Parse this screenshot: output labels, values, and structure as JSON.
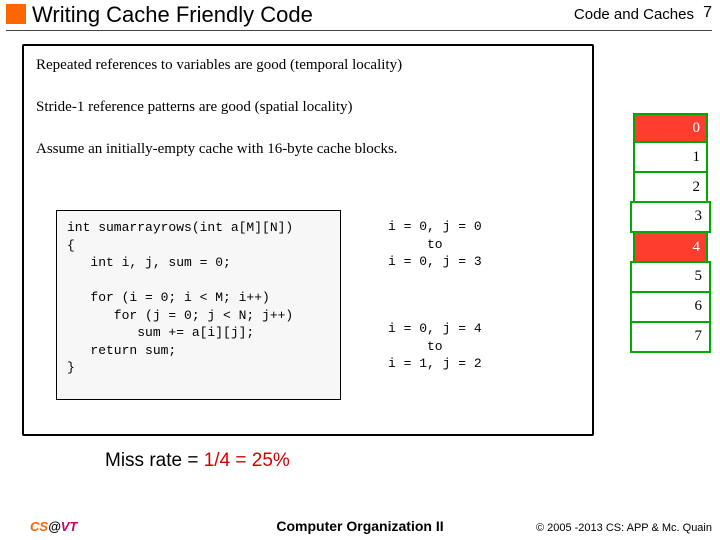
{
  "header": {
    "title": "Writing Cache Friendly Code",
    "topic": "Code and Caches",
    "page": "7"
  },
  "body": {
    "line1": "Repeated references to variables are good (temporal locality)",
    "line2": "Stride-1 reference patterns are good (spatial locality)",
    "line3": "Assume an initially-empty cache with 16-byte cache blocks."
  },
  "code": "int sumarrayrows(int a[M][N])\n{\n   int i, j, sum = 0;\n\n   for (i = 0; i < M; i++)\n      for (j = 0; j < N; j++)\n         sum += a[i][j];\n   return sum;\n}",
  "annot": {
    "a1": "i = 0, j = 0\n     to\ni = 0, j = 3",
    "a2": "i = 0, j = 4\n     to\ni = 1, j = 2"
  },
  "miss": {
    "label": "Miss rate = ",
    "value": "1/4 = 25%"
  },
  "cells": [
    "0",
    "1",
    "2",
    "3",
    "4",
    "5",
    "6",
    "7"
  ],
  "footer": {
    "cs": "CS",
    "at": "@",
    "vt": "VT",
    "course": "Computer Organization II",
    "copyright": "© 2005 -2013 CS: APP & Mc. Quain"
  }
}
